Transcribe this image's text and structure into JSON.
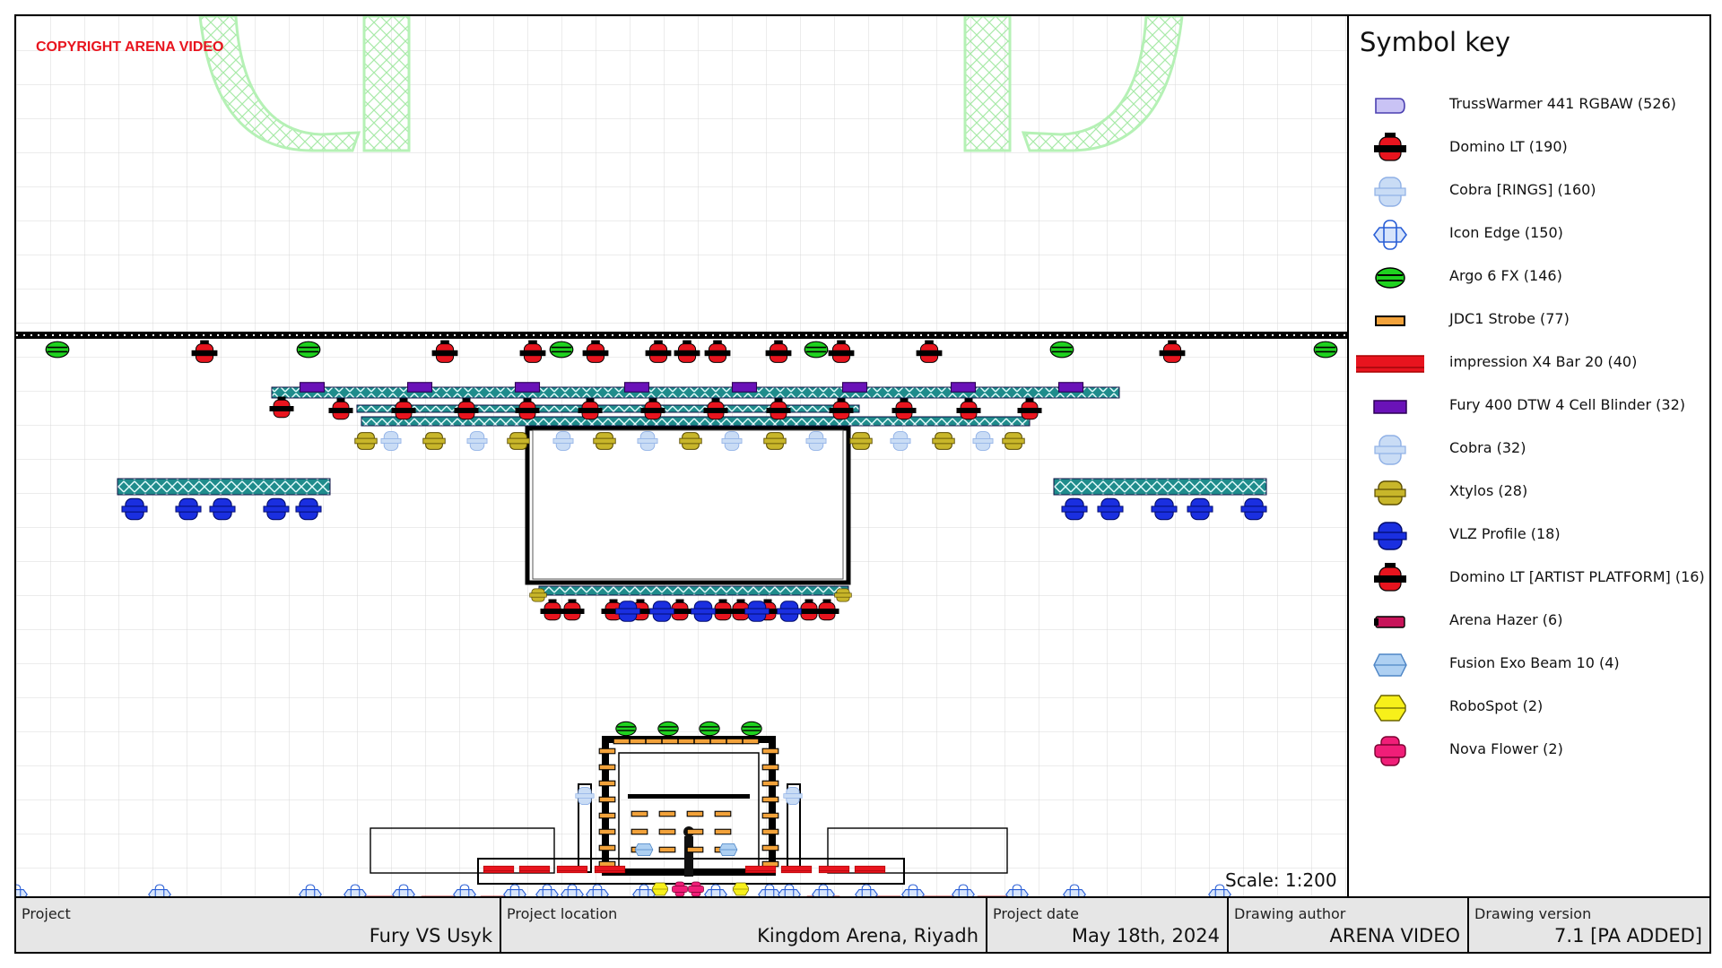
{
  "copyright": "COPYRIGHT ARENA VIDEO",
  "scale": "Scale: 1:200",
  "legend": {
    "title": "Symbol key",
    "items": [
      {
        "label": "TrussWarmer 441 RGBAW (526)",
        "icon": "trusswarmer-icon",
        "color": "#c9c3f5"
      },
      {
        "label": "Domino LT (190)",
        "icon": "domino-lt-icon",
        "color": "#e8141e"
      },
      {
        "label": "Cobra [RINGS] (160)",
        "icon": "cobra-rings-icon",
        "color": "#c9dcf5"
      },
      {
        "label": "Icon Edge (150)",
        "icon": "icon-edge-icon",
        "color": "#d6e4fb"
      },
      {
        "label": "Argo 6 FX (146)",
        "icon": "argo-6-fx-icon",
        "color": "#1fd21f"
      },
      {
        "label": "JDC1 Strobe (77)",
        "icon": "jdc1-strobe-icon",
        "color": "#f2a23a"
      },
      {
        "label": "impression X4 Bar 20 (40)",
        "icon": "impression-x4-bar-icon",
        "color": "#e8141e"
      },
      {
        "label": "Fury 400 DTW 4 Cell Blinder (32)",
        "icon": "fury-blinder-icon",
        "color": "#6a12b8"
      },
      {
        "label": "Cobra (32)",
        "icon": "cobra-icon",
        "color": "#c9dcf5"
      },
      {
        "label": "Xtylos (28)",
        "icon": "xtylos-icon",
        "color": "#c8b62a"
      },
      {
        "label": "VLZ Profile (18)",
        "icon": "vlz-profile-icon",
        "color": "#1a2fe0"
      },
      {
        "label": "Domino LT [ARTIST PLATFORM] (16)",
        "icon": "domino-lt-artist-icon",
        "color": "#e8141e"
      },
      {
        "label": "Arena Hazer (6)",
        "icon": "arena-hazer-icon",
        "color": "#c8145a"
      },
      {
        "label": "Fusion Exo Beam 10 (4)",
        "icon": "fusion-exo-beam-icon",
        "color": "#aed0f2"
      },
      {
        "label": "RoboSpot (2)",
        "icon": "robospot-icon",
        "color": "#f7f01a"
      },
      {
        "label": "Nova Flower (2)",
        "icon": "nova-flower-icon",
        "color": "#f01e78"
      }
    ]
  },
  "title_block": {
    "project": {
      "label": "Project",
      "value": "Fury VS Usyk"
    },
    "location": {
      "label": "Project location",
      "value": "Kingdom Arena, Riyadh"
    },
    "date": {
      "label": "Project date",
      "value": "May 18th, 2024"
    },
    "author": {
      "label": "Drawing author",
      "value": "ARENA VIDEO"
    },
    "version": {
      "label": "Drawing version",
      "value": "7.1 [PA ADDED]"
    }
  },
  "colors": {
    "grid": "#d8d8d8",
    "truss": "#1f8c8c",
    "screen_outline": "#000000",
    "ghost_truss": "#b9f2b9"
  }
}
